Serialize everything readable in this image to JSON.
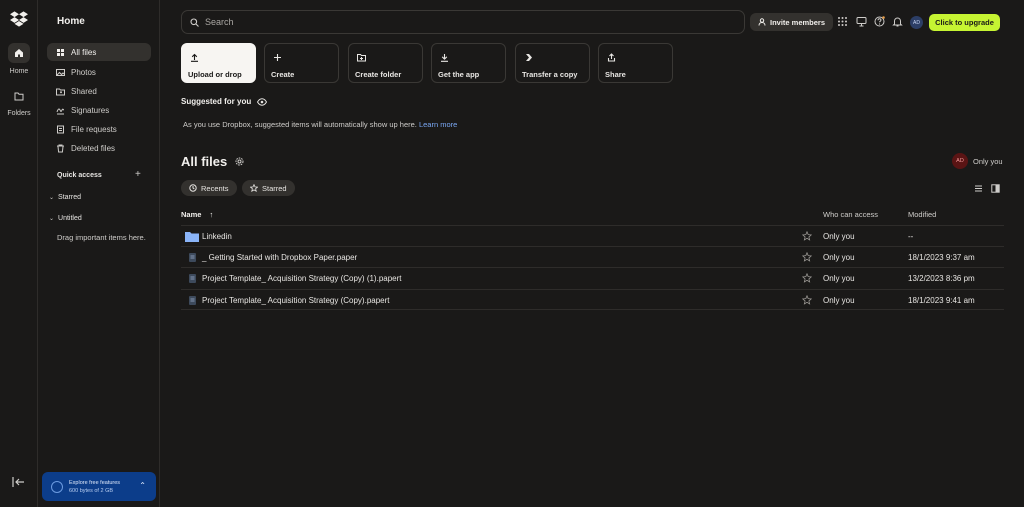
{
  "rail": {
    "items": [
      {
        "label": "Home"
      },
      {
        "label": "Folders"
      }
    ]
  },
  "sidebar": {
    "title": "Home",
    "nav": [
      {
        "label": "All files"
      },
      {
        "label": "Photos"
      },
      {
        "label": "Shared"
      },
      {
        "label": "Signatures"
      },
      {
        "label": "File requests"
      },
      {
        "label": "Deleted files"
      }
    ],
    "quick_access": "Quick access",
    "starred": "Starred",
    "untitled": "Untitled",
    "drag_hint": "Drag important items here.",
    "promo": {
      "line1": "Explore free features",
      "line2": "600 bytes of 2 GB"
    }
  },
  "topbar": {
    "search_placeholder": "Search",
    "invite": "Invite members",
    "avatar": "AD",
    "upgrade": "Click to upgrade"
  },
  "actions": [
    {
      "label": "Upload or drop"
    },
    {
      "label": "Create"
    },
    {
      "label": "Create folder"
    },
    {
      "label": "Get the app"
    },
    {
      "label": "Transfer a copy"
    },
    {
      "label": "Share"
    }
  ],
  "suggested": {
    "title": "Suggested for you",
    "text": "As you use Dropbox, suggested items will automatically show up here.",
    "link": "Learn more"
  },
  "files": {
    "title": "All files",
    "owner_avatar": "AD",
    "owner_filter": "Only you",
    "chips": [
      {
        "label": "Recents"
      },
      {
        "label": "Starred"
      }
    ],
    "columns": {
      "name": "Name",
      "who": "Who can access",
      "modified": "Modified"
    },
    "rows": [
      {
        "name": "Linkedin",
        "who": "Only you",
        "modified": "--"
      },
      {
        "name": "_ Getting Started with Dropbox Paper.paper",
        "who": "Only you",
        "modified": "18/1/2023 9:37 am"
      },
      {
        "name": "Project Template_ Acquisition Strategy (Copy) (1).papert",
        "who": "Only you",
        "modified": "13/2/2023 8:36 pm"
      },
      {
        "name": "Project Template_ Acquisition Strategy (Copy).papert",
        "who": "Only you",
        "modified": "18/1/2023 9:41 am"
      }
    ]
  },
  "colors": {
    "accent": "#c6f432",
    "link": "#7aa8f5",
    "folder": "#8ab4f8"
  }
}
